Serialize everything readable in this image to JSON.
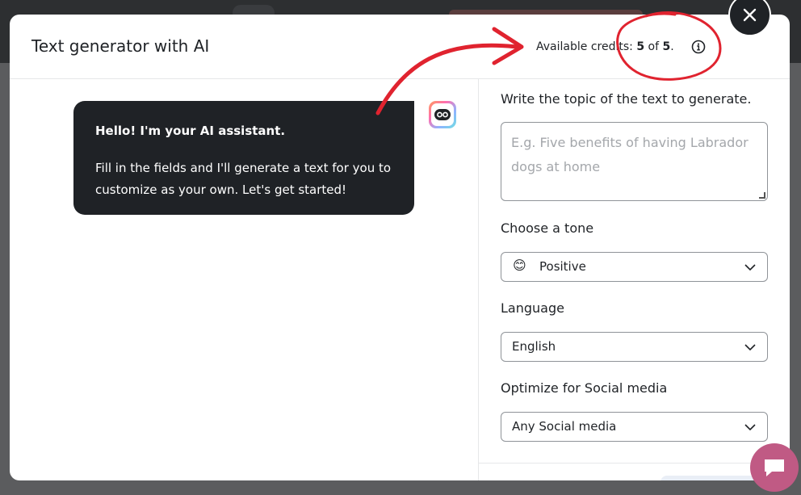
{
  "modal": {
    "title": "Text generator with AI",
    "credits_prefix": "Available credits: ",
    "credits_used": "5",
    "credits_of": " of ",
    "credits_total": "5",
    "credits_suffix": "."
  },
  "assistant": {
    "greeting": "Hello! I'm your AI assistant.",
    "message": "Fill in the fields and I'll generate a text for you to customize as your own. Let's get started!"
  },
  "form": {
    "topic_label": "Write the topic of the text to generate.",
    "topic_placeholder": "E.g. Five benefits of having Labrador dogs at home",
    "tone_label": "Choose a tone",
    "tone_emoji": "😊",
    "tone_value": "Positive",
    "language_label": "Language",
    "language_value": "English",
    "social_label": "Optimize for Social media",
    "social_value": "Any Social media"
  },
  "icons": {
    "close": "close-icon",
    "info": "info-icon",
    "chat": "chat-bubble-icon",
    "bot": "robot-icon"
  },
  "colors": {
    "dark": "#1f2226",
    "annotation_red": "#e0232f",
    "chat_fab": "#c05a84"
  }
}
